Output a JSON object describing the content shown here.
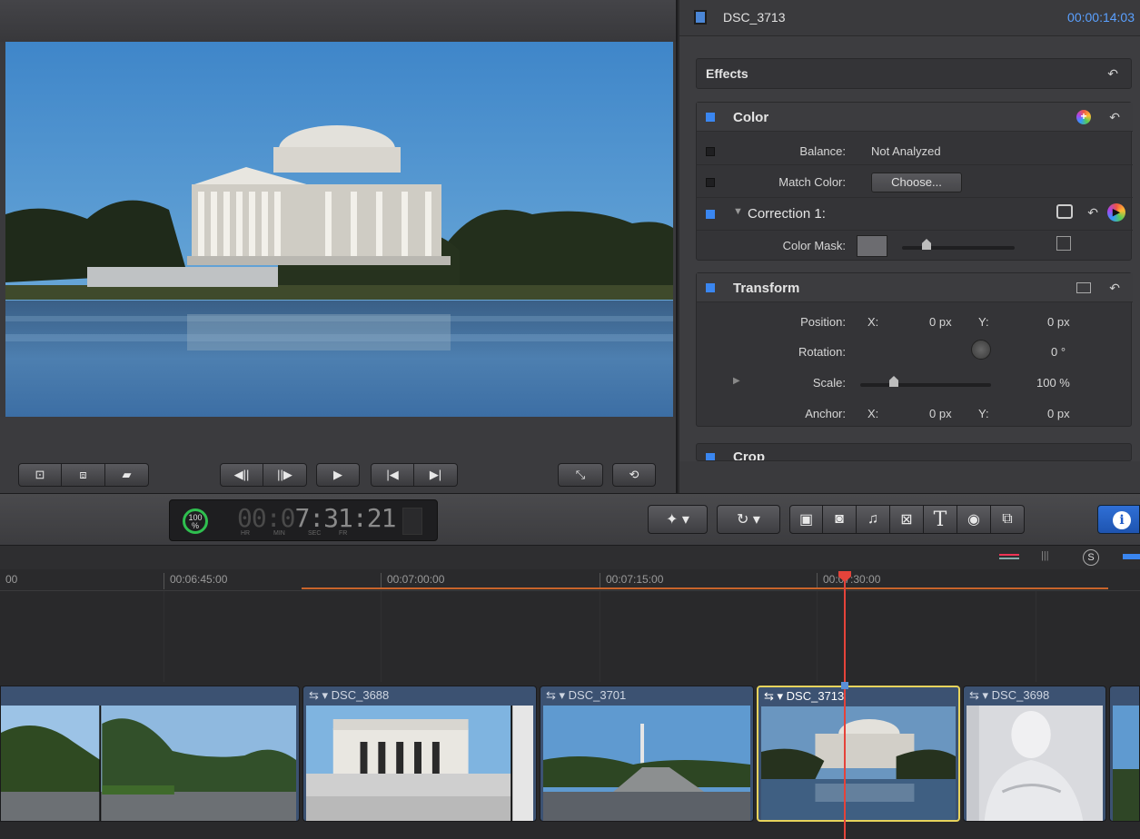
{
  "inspector": {
    "clip_name": "DSC_3713",
    "timecode": "00:00:14:03",
    "effects": {
      "title": "Effects"
    },
    "color": {
      "title": "Color",
      "balance_label": "Balance:",
      "balance_value": "Not Analyzed",
      "match_label": "Match Color:",
      "match_button": "Choose...",
      "correction_label": "Correction 1:",
      "mask_label": "Color Mask:"
    },
    "transform": {
      "title": "Transform",
      "position_label": "Position:",
      "x_label": "X:",
      "x_value": "0 px",
      "y_label": "Y:",
      "y_value": "0 px",
      "rotation_label": "Rotation:",
      "rotation_value": "0 °",
      "scale_label": "Scale:",
      "scale_value": "100 %",
      "anchor_label": "Anchor:",
      "anchor_x_label": "X:",
      "anchor_x_value": "0 px",
      "anchor_y_label": "Y:",
      "anchor_y_value": "0 px"
    },
    "crop": {
      "title": "Crop"
    }
  },
  "dashboard": {
    "percent": "100",
    "percent_sign": "%",
    "timecode_dim": "00:0",
    "timecode_main": "7:31:21",
    "labels": [
      "HR",
      "MIN",
      "SEC",
      "FR"
    ]
  },
  "timeline": {
    "ruler": [
      "00",
      "00:06:45:00",
      "00:07:00:00",
      "00:07:15:00",
      "00:07:30:00"
    ],
    "clips": [
      {
        "name": ""
      },
      {
        "name": "DSC_3688"
      },
      {
        "name": "DSC_3701"
      },
      {
        "name": "DSC_3713"
      },
      {
        "name": "DSC_3698"
      }
    ]
  },
  "toolbar": {
    "icons": [
      "magic-wand-icon",
      "retime-icon",
      "clip-browser-icon",
      "photo-browser-icon",
      "music-browser-icon",
      "transitions-icon",
      "titles-icon",
      "generators-icon",
      "themes-icon",
      "info-icon"
    ],
    "titles_glyph": "T",
    "info_glyph": "i"
  },
  "colors": {
    "accent": "#3a86f0",
    "timecode": "#5aa0ff",
    "playhead": "#e5433a",
    "selection": "#e7d35c",
    "range": "#c8642b"
  }
}
